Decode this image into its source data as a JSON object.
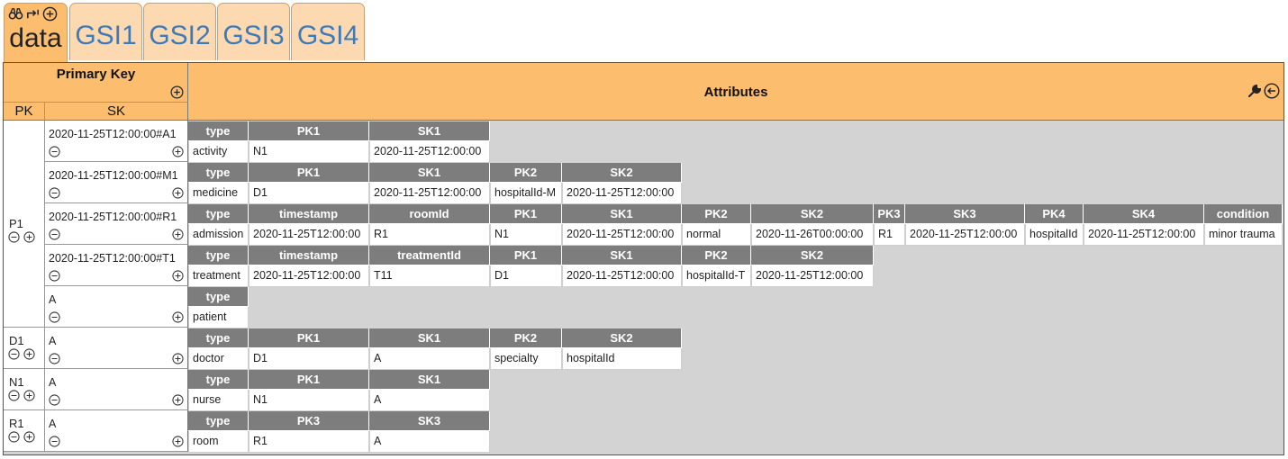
{
  "tabs": [
    {
      "label": "data",
      "active": true
    },
    {
      "label": "GSI1",
      "active": false
    },
    {
      "label": "GSI2",
      "active": false
    },
    {
      "label": "GSI3",
      "active": false
    },
    {
      "label": "GSI4",
      "active": false
    }
  ],
  "headers": {
    "primary_key": "Primary Key",
    "pk": "PK",
    "sk": "SK",
    "attributes": "Attributes"
  },
  "colors": {
    "header_orange": "#fcbd6f",
    "tab_inactive": "#fdd9b1",
    "cell_header_gray": "#7d7d7d",
    "background_gray": "#d3d3d3",
    "tab_text_blue": "#3d7ab8"
  },
  "icons": {
    "tab_tools": [
      "binoculars-icon",
      "swap-icon",
      "add-circle-icon"
    ],
    "attr_tools": [
      "wrench-icon",
      "collapse-left-icon"
    ]
  },
  "partitions": [
    {
      "pk": "P1",
      "rows": [
        {
          "sk": "2020-11-25T12:00:00#A1",
          "attrs": [
            {
              "h": "type",
              "v": "activity"
            },
            {
              "h": "PK1",
              "v": "N1"
            },
            {
              "h": "SK1",
              "v": "2020-11-25T12:00:00"
            }
          ]
        },
        {
          "sk": "2020-11-25T12:00:00#M1",
          "attrs": [
            {
              "h": "type",
              "v": "medicine"
            },
            {
              "h": "PK1",
              "v": "D1"
            },
            {
              "h": "SK1",
              "v": "2020-11-25T12:00:00"
            },
            {
              "h": "PK2",
              "v": "hospitalId-M"
            },
            {
              "h": "SK2",
              "v": "2020-11-25T12:00:00"
            }
          ]
        },
        {
          "sk": "2020-11-25T12:00:00#R1",
          "attrs": [
            {
              "h": "type",
              "v": "admission"
            },
            {
              "h": "timestamp",
              "v": "2020-11-25T12:00:00"
            },
            {
              "h": "roomId",
              "v": "R1"
            },
            {
              "h": "PK1",
              "v": "N1"
            },
            {
              "h": "SK1",
              "v": "2020-11-25T12:00:00"
            },
            {
              "h": "PK2",
              "v": "normal"
            },
            {
              "h": "SK2",
              "v": "2020-11-26T00:00:00"
            },
            {
              "h": "PK3",
              "v": "R1"
            },
            {
              "h": "SK3",
              "v": "2020-11-25T12:00:00"
            },
            {
              "h": "PK4",
              "v": "hospitalId"
            },
            {
              "h": "SK4",
              "v": "2020-11-25T12:00:00"
            },
            {
              "h": "condition",
              "v": "minor trauma"
            }
          ]
        },
        {
          "sk": "2020-11-25T12:00:00#T1",
          "attrs": [
            {
              "h": "type",
              "v": "treatment"
            },
            {
              "h": "timestamp",
              "v": "2020-11-25T12:00:00"
            },
            {
              "h": "treatmentId",
              "v": "T11"
            },
            {
              "h": "PK1",
              "v": "D1"
            },
            {
              "h": "SK1",
              "v": "2020-11-25T12:00:00"
            },
            {
              "h": "PK2",
              "v": "hospitalId-T"
            },
            {
              "h": "SK2",
              "v": "2020-11-25T12:00:00"
            }
          ]
        },
        {
          "sk": "A",
          "attrs": [
            {
              "h": "type",
              "v": "patient"
            }
          ]
        }
      ]
    },
    {
      "pk": "D1",
      "rows": [
        {
          "sk": "A",
          "attrs": [
            {
              "h": "type",
              "v": "doctor"
            },
            {
              "h": "PK1",
              "v": "D1"
            },
            {
              "h": "SK1",
              "v": "A"
            },
            {
              "h": "PK2",
              "v": "specialty"
            },
            {
              "h": "SK2",
              "v": "hospitalId"
            }
          ]
        }
      ]
    },
    {
      "pk": "N1",
      "rows": [
        {
          "sk": "A",
          "attrs": [
            {
              "h": "type",
              "v": "nurse"
            },
            {
              "h": "PK1",
              "v": "N1"
            },
            {
              "h": "SK1",
              "v": "A"
            }
          ]
        }
      ]
    },
    {
      "pk": "R1",
      "rows": [
        {
          "sk": "A",
          "attrs": [
            {
              "h": "type",
              "v": "room"
            },
            {
              "h": "PK3",
              "v": "R1"
            },
            {
              "h": "SK3",
              "v": "A"
            }
          ]
        }
      ]
    }
  ]
}
